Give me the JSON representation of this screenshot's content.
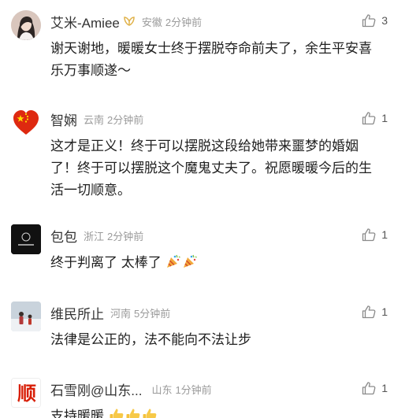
{
  "comments": [
    {
      "user": "艾米-Amiee",
      "location": "安徽",
      "time": "2分钟前",
      "likes": "3",
      "text": "谢天谢地，暖暖女士终于摆脱夺命前夫了，余生平安喜乐万事顺遂～",
      "avatar_icon": "woman-portrait-avatar",
      "badge_icon": "gold-ribbon-badge-icon"
    },
    {
      "user": "智娴",
      "location": "云南",
      "time": "2分钟前",
      "likes": "1",
      "text": "这才是正义！终于可以摆脱这段给她带来噩梦的婚姻了！终于可以摆脱这个魔鬼丈夫了。祝愿暖暖今后的生活一切顺意。",
      "avatar_icon": "china-flag-heart-avatar"
    },
    {
      "user": "包包",
      "location": "浙江",
      "time": "2分钟前",
      "likes": "1",
      "text": "终于判离了 太棒了",
      "emoji": [
        "party-popper-icon",
        "party-popper-icon"
      ],
      "avatar_icon": "dark-logo-avatar"
    },
    {
      "user": "维民所止",
      "location": "河南",
      "time": "5分钟前",
      "likes": "1",
      "text": "法律是公正的，法不能向不法让步",
      "avatar_icon": "family-snow-photo-avatar"
    },
    {
      "user": "石雪刚@山东...",
      "location": "山东",
      "time": "1分钟前",
      "likes": "1",
      "text": "支持暖暖",
      "emoji": [
        "thumbs-up-icon",
        "thumbs-up-icon",
        "thumbs-up-icon"
      ],
      "avatar_icon": "shun-logo-avatar",
      "avatar_text": "顺"
    }
  ],
  "colors": {
    "meta_gray": "#9a9a9a",
    "name": "#333333",
    "body_text": "#1f1f1f",
    "like_icon": "#8a8a8a"
  }
}
